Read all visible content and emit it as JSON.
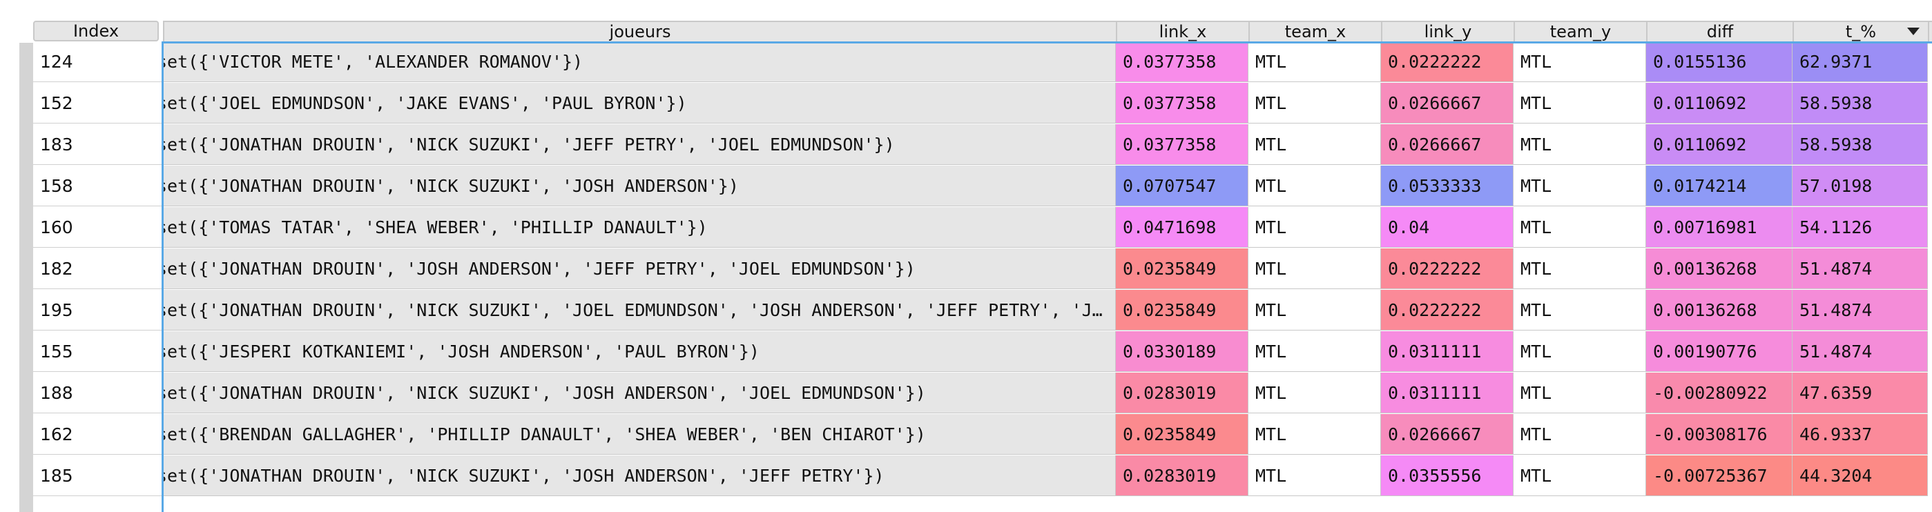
{
  "table": {
    "index_header": "Index",
    "columns": [
      {
        "key": "joueurs",
        "label": "joueurs"
      },
      {
        "key": "link_x",
        "label": "link_x"
      },
      {
        "key": "team_x",
        "label": "team_x"
      },
      {
        "key": "link_y",
        "label": "link_y"
      },
      {
        "key": "team_y",
        "label": "team_y"
      },
      {
        "key": "diff",
        "label": "diff"
      },
      {
        "key": "t_pct",
        "label": "t_%"
      }
    ],
    "sort_indicator": "sort-descending-icon",
    "rows": [
      {
        "index": "124",
        "joueurs": "set({'VICTOR METE', 'ALEXANDER ROMANOV'})",
        "link_x": "0.0377358",
        "team_x": "MTL",
        "link_y": "0.0222222",
        "team_y": "MTL",
        "diff": "0.0155136",
        "t_pct": "62.9371",
        "colors": {
          "link_x": "#f88cea",
          "link_y": "#fb8a98",
          "diff": "#aa8cf6",
          "t_pct": "#9b8ef5"
        }
      },
      {
        "index": "152",
        "joueurs": "set({'JOEL EDMUNDSON', 'JAKE EVANS', 'PAUL BYRON'})",
        "link_x": "0.0377358",
        "team_x": "MTL",
        "link_y": "0.0266667",
        "team_y": "MTL",
        "diff": "0.0110692",
        "t_pct": "58.5938",
        "colors": {
          "link_x": "#f88cea",
          "link_y": "#f78cbc",
          "diff": "#c98cf5",
          "t_pct": "#c18cf7"
        }
      },
      {
        "index": "183",
        "joueurs": "set({'JONATHAN DROUIN', 'NICK SUZUKI', 'JEFF PETRY', 'JOEL EDMUNDSON'})",
        "link_x": "0.0377358",
        "team_x": "MTL",
        "link_y": "0.0266667",
        "team_y": "MTL",
        "diff": "0.0110692",
        "t_pct": "58.5938",
        "colors": {
          "link_x": "#f88cea",
          "link_y": "#f78cbc",
          "diff": "#c98cf5",
          "t_pct": "#c18cf7"
        }
      },
      {
        "index": "158",
        "joueurs": "set({'JONATHAN DROUIN', 'NICK SUZUKI', 'JOSH ANDERSON'})",
        "link_x": "0.0707547",
        "team_x": "MTL",
        "link_y": "0.0533333",
        "team_y": "MTL",
        "diff": "0.0174214",
        "t_pct": "57.0198",
        "colors": {
          "link_x": "#8e9af6",
          "link_y": "#8e9af6",
          "diff": "#8e9af6",
          "t_pct": "#d08cf5"
        }
      },
      {
        "index": "160",
        "joueurs": "set({'TOMAS TATAR', 'SHEA WEBER', 'PHILLIP DANAULT'})",
        "link_x": "0.0471698",
        "team_x": "MTL",
        "link_y": "0.04",
        "team_y": "MTL",
        "diff": "0.00716981",
        "t_pct": "54.1126",
        "colors": {
          "link_x": "#f58af6",
          "link_y": "#f58af6",
          "diff": "#ec8cf0",
          "t_pct": "#e98cf2"
        }
      },
      {
        "index": "182",
        "joueurs": "set({'JONATHAN DROUIN', 'JOSH ANDERSON', 'JEFF PETRY', 'JOEL EDMUNDSON'})",
        "link_x": "0.0235849",
        "team_x": "MTL",
        "link_y": "0.0222222",
        "team_y": "MTL",
        "diff": "0.00136268",
        "t_pct": "51.4874",
        "colors": {
          "link_x": "#fb8a8e",
          "link_y": "#fb8a98",
          "diff": "#f68cd6",
          "t_pct": "#f48cd8"
        }
      },
      {
        "index": "195",
        "joueurs": "set({'JONATHAN DROUIN', 'NICK SUZUKI', 'JOEL EDMUNDSON', 'JOSH ANDERSON', 'JEFF PETRY', 'JAKE EVANS'})",
        "link_x": "0.0235849",
        "team_x": "MTL",
        "link_y": "0.0222222",
        "team_y": "MTL",
        "diff": "0.00136268",
        "t_pct": "51.4874",
        "colors": {
          "link_x": "#fb8a8e",
          "link_y": "#fb8a98",
          "diff": "#f68cd6",
          "t_pct": "#f48cd8"
        }
      },
      {
        "index": "155",
        "joueurs": "set({'JESPERI KOTKANIEMI', 'JOSH ANDERSON', 'PAUL BYRON'})",
        "link_x": "0.0330189",
        "team_x": "MTL",
        "link_y": "0.0311111",
        "team_y": "MTL",
        "diff": "0.00190776",
        "t_pct": "51.4874",
        "colors": {
          "link_x": "#f88cd0",
          "link_y": "#f78ce0",
          "diff": "#f68cdc",
          "t_pct": "#f48cd8"
        }
      },
      {
        "index": "188",
        "joueurs": "set({'JONATHAN DROUIN', 'NICK SUZUKI', 'JOSH ANDERSON', 'JOEL EDMUNDSON'})",
        "link_x": "0.0283019",
        "team_x": "MTL",
        "link_y": "0.0311111",
        "team_y": "MTL",
        "diff": "-0.00280922",
        "t_pct": "47.6359",
        "colors": {
          "link_x": "#fa8aa6",
          "link_y": "#f78ce0",
          "diff": "#f98aac",
          "t_pct": "#fa8aa8"
        }
      },
      {
        "index": "162",
        "joueurs": "set({'BRENDAN GALLAGHER', 'PHILLIP DANAULT', 'SHEA WEBER', 'BEN CHIAROT'})",
        "link_x": "0.0235849",
        "team_x": "MTL",
        "link_y": "0.0266667",
        "team_y": "MTL",
        "diff": "-0.00308176",
        "t_pct": "46.9337",
        "colors": {
          "link_x": "#fb8a8e",
          "link_y": "#f78cbc",
          "diff": "#fa8aa6",
          "t_pct": "#fb8a9a"
        }
      },
      {
        "index": "185",
        "joueurs": "set({'JONATHAN DROUIN', 'NICK SUZUKI', 'JOSH ANDERSON', 'JEFF PETRY'})",
        "link_x": "0.0283019",
        "team_x": "MTL",
        "link_y": "0.0355556",
        "team_y": "MTL",
        "diff": "-0.00725367",
        "t_pct": "44.3204",
        "colors": {
          "link_x": "#fa8aa6",
          "link_y": "#f58af6",
          "diff": "#fc8a86",
          "t_pct": "#fc8a86"
        }
      }
    ]
  }
}
